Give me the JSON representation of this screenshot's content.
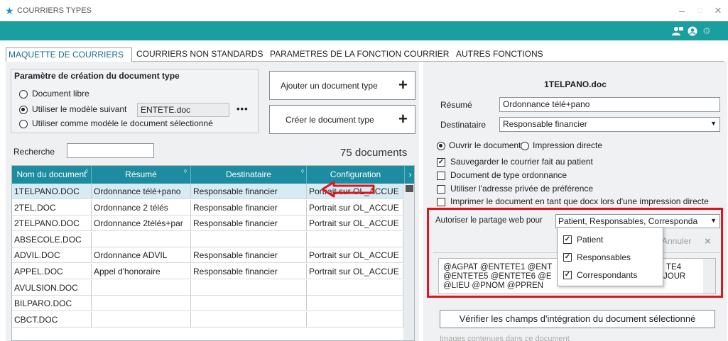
{
  "window": {
    "title": "COURRIERS TYPES",
    "minimize": "–",
    "maximize": "□",
    "close": "×"
  },
  "toolbar_icons": [
    "user-group-icon",
    "help-icon",
    "settings-icon"
  ],
  "tabs": [
    {
      "label": "MAQUETTE DE COURRIERS",
      "active": true
    },
    {
      "label": "COURRIERS NON STANDARDS",
      "active": false
    },
    {
      "label": "PARAMETRES DE LA FONCTION COURRIER",
      "active": false
    },
    {
      "label": "AUTRES FONCTIONS",
      "active": false
    }
  ],
  "param": {
    "title": "Paramètre de création du document type",
    "option_libre": "Document libre",
    "option_modele": "Utiliser le modèle suivant",
    "model_value": "ENTETE.doc",
    "browse": "•••",
    "option_selection": "Utiliser comme modèle le document sélectionné",
    "selected_option": "modele"
  },
  "buttons": {
    "add": "Ajouter un document type",
    "create": "Créer le document type",
    "plus": "+"
  },
  "search": {
    "label": "Recherche",
    "value": ""
  },
  "count": "75 documents",
  "table": {
    "columns": [
      "Nom du document",
      "Résumé",
      "Destinataire",
      "Configuration"
    ],
    "rows": [
      [
        "1TELPANO.DOC",
        "Ordonnance télé+pano",
        "Responsable financier",
        "Portrait sur OL_ACCUE"
      ],
      [
        "2TEL.DOC",
        "Ordonnance 2 télés",
        "Responsable financier",
        "Portrait sur OL_ACCUE"
      ],
      [
        "2TELPANO.DOC",
        "Ordonnance 2télés+par",
        "Responsable financier",
        "Portrait sur OL_ACCUE"
      ],
      [
        "ABSECOLE.DOC",
        "",
        "",
        ""
      ],
      [
        "ADVIL.DOC",
        "Ordonnance ADVIL",
        "Responsable financier",
        "Portrait sur OL_ACCUE"
      ],
      [
        "APPEL.DOC",
        "Appel d'honoraire",
        "Responsable financier",
        "Portrait sur OL_ACCUE"
      ],
      [
        "AVULSION.DOC",
        "",
        "",
        ""
      ],
      [
        "BILPARO.DOC",
        "",
        "",
        ""
      ],
      [
        "CBCT.DOC",
        "",
        "",
        ""
      ]
    ],
    "selected_row": 0
  },
  "detail": {
    "filename": "1TELPANO.doc",
    "resume_label": "Résumé",
    "resume_value": "Ordonnance télé+pano",
    "dest_label": "Destinataire",
    "dest_value": "Responsable financier",
    "open_doc": "Ouvrir le document",
    "direct_print": "Impression directe",
    "open_selected": true,
    "checks": [
      {
        "label": "Sauvegarder le courrier fait au patient",
        "checked": true
      },
      {
        "label": "Document de type ordonnance",
        "checked": false
      },
      {
        "label": "Utiliser l'adresse privée de préférence",
        "checked": false
      },
      {
        "label": "Imprimer le document en tant que docx lors d'une impression directe",
        "checked": false
      }
    ],
    "partage_label": "Autoriser le partage web pour",
    "partage_value": "Patient, Responsables, Corresponda",
    "partage_options": [
      {
        "label": "Patient",
        "checked": true
      },
      {
        "label": "Responsables",
        "checked": true
      },
      {
        "label": "Correspondants",
        "checked": true
      }
    ],
    "cancel": "Annuler",
    "cancel_icon": "×",
    "fields_text_line1": "@AGPAT @ENTETE1 @ENT",
    "fields_text_line1_tail": "TE4",
    "fields_text_line2": "@ENTETE5 @ENTETE6 @E",
    "fields_text_line2_tail": "JOUR",
    "fields_text_line3": "@LIEU @PNOM @PPREN",
    "verify_button": "Vérifier les champs d'intégration du document sélectionné",
    "images_label": "Images contenues dans ce document"
  },
  "colors": {
    "teal_band": "#1b9e9e",
    "table_header": "#1d8ca0",
    "highlight_frame": "#e0141b",
    "arrow": "#e0141b"
  }
}
